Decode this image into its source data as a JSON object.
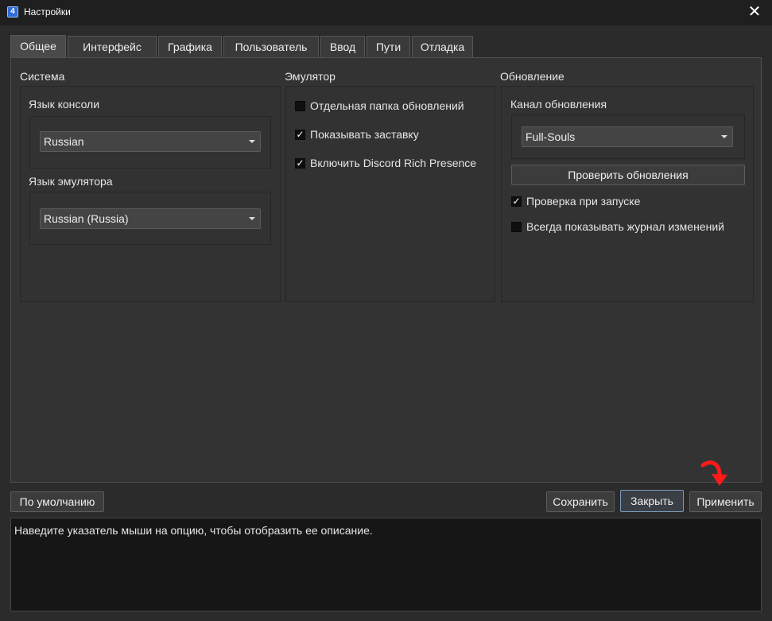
{
  "window": {
    "title": "Настройки",
    "close_symbol": "✕"
  },
  "tabs": [
    {
      "label": "Общее",
      "active": true
    },
    {
      "label": "Интерфейс"
    },
    {
      "label": "Графика"
    },
    {
      "label": "Пользователь"
    },
    {
      "label": "Ввод"
    },
    {
      "label": "Пути"
    },
    {
      "label": "Отладка"
    }
  ],
  "system": {
    "title": "Система",
    "console_language_label": "Язык консоли",
    "console_language_value": "Russian",
    "emulator_language_label": "Язык эмулятора",
    "emulator_language_value": "Russian (Russia)"
  },
  "emulator": {
    "title": "Эмулятор",
    "options": [
      {
        "label": "Отдельная папка обновлений",
        "checked": false
      },
      {
        "label": "Показывать заставку",
        "checked": true
      },
      {
        "label": "Включить Discord Rich Presence",
        "checked": true
      }
    ]
  },
  "update": {
    "title": "Обновление",
    "channel_label": "Канал обновления",
    "channel_value": "Full-Souls",
    "check_button": "Проверить обновления",
    "options": [
      {
        "label": "Проверка при запуске",
        "checked": true
      },
      {
        "label": "Всегда показывать журнал изменений",
        "checked": false
      }
    ]
  },
  "footer": {
    "defaults_button": "По умолчанию",
    "save_button": "Сохранить",
    "close_button": "Закрыть",
    "apply_button": "Применить"
  },
  "description": {
    "text": "Наведите указатель мыши на опцию, чтобы отобразить ее описание."
  },
  "check_mark": "✓",
  "colors": {
    "background": "#2b2b2b",
    "annotation_arrow": "#ff1a1a",
    "primary_button_border": "#7f9bbd"
  }
}
